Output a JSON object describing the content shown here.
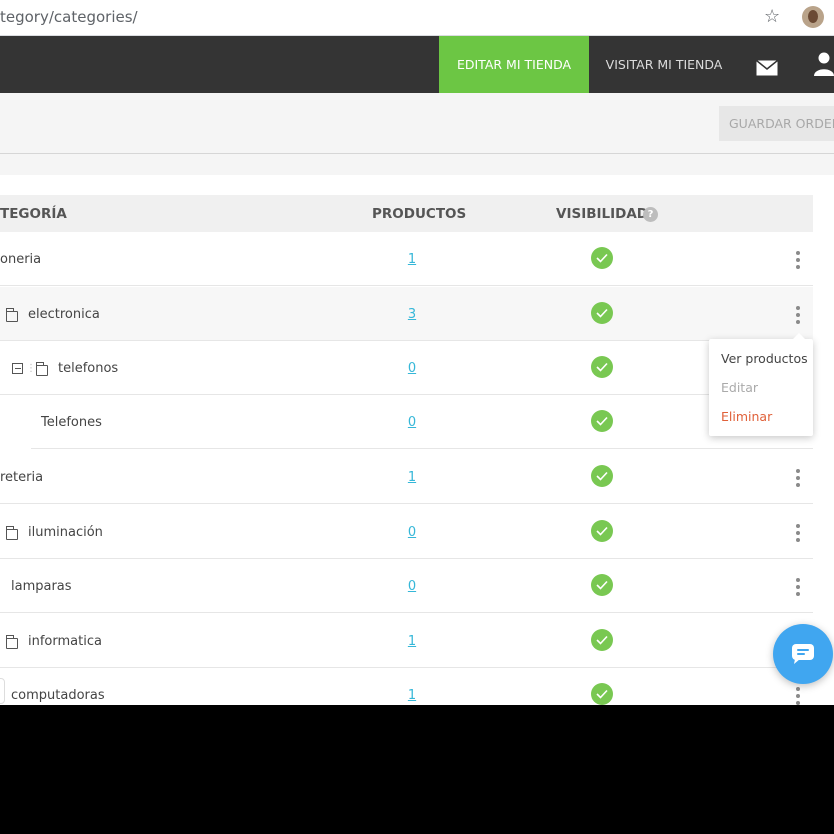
{
  "browser": {
    "url": "tegory/categories/"
  },
  "nav": {
    "edit_store": "EDITAR MI TIENDA",
    "visit_store": "VISITAR MI TIENDA"
  },
  "toolbar": {
    "save_order": "GUARDAR ORDEN"
  },
  "table": {
    "headers": {
      "category": "TEGORÍA",
      "products": "PRODUCTOS",
      "visibility": "VISIBILIDAD",
      "help": "?"
    },
    "rows": [
      {
        "name": "oneria",
        "count": "1",
        "visible": true
      },
      {
        "name": "electronica",
        "count": "3",
        "visible": true
      },
      {
        "name": "telefonos",
        "count": "0",
        "visible": true
      },
      {
        "name": "Telefones",
        "count": "0",
        "visible": true
      },
      {
        "name": "reteria",
        "count": "1",
        "visible": true
      },
      {
        "name": "iluminación",
        "count": "0",
        "visible": true
      },
      {
        "name": "lamparas",
        "count": "0",
        "visible": true
      },
      {
        "name": "informatica",
        "count": "1",
        "visible": true
      },
      {
        "name": "computadoras",
        "count": "1",
        "visible": true
      }
    ]
  },
  "dropdown": {
    "view_products": "Ver productos",
    "edit": "Editar",
    "delete": "Eliminar"
  },
  "colors": {
    "accent_green": "#6cc644",
    "check_green": "#79c852",
    "link_blue": "#35b7d8",
    "danger": "#e0613a",
    "chat_blue": "#40a6f0"
  },
  "icons": [
    "star-icon",
    "mail-icon",
    "user-icon",
    "help-icon",
    "folder-icon",
    "collapse-icon",
    "check-icon",
    "more-vertical-icon",
    "chat-icon"
  ]
}
